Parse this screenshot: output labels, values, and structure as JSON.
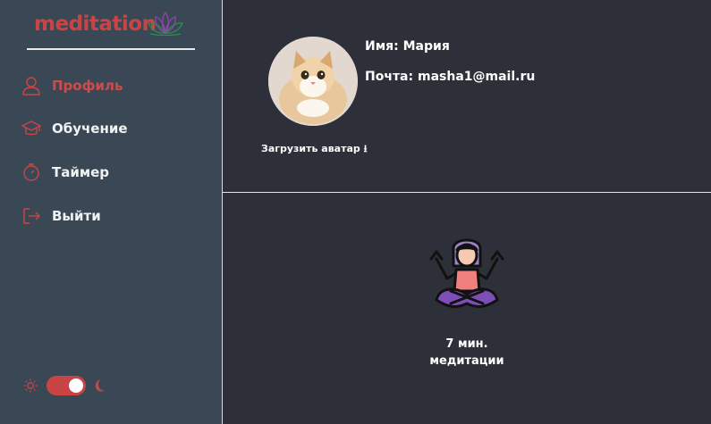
{
  "brand": {
    "name": "meditation",
    "color": "#c94545"
  },
  "sidebar": {
    "items": [
      {
        "label": "Профиль",
        "icon": "user-icon",
        "active": true
      },
      {
        "label": "Обучение",
        "icon": "graduation-cap-icon",
        "active": false
      },
      {
        "label": "Таймер",
        "icon": "stopwatch-icon",
        "active": false
      },
      {
        "label": "Выйти",
        "icon": "logout-icon",
        "active": false
      }
    ],
    "theme_toggle": {
      "state": "on",
      "left_icon": "sun-icon",
      "right_icon": "moon-icon"
    }
  },
  "profile": {
    "name_line": "Имя: Мария",
    "email_line": "Почта: masha1@mail.ru",
    "upload_label": "Загрузить аватар ⭳",
    "avatar": "cat-photo-avatar"
  },
  "stats": {
    "illustration": "meditating-person-icon",
    "line1": "7 мин.",
    "line2": "медитации"
  },
  "colors": {
    "accent": "#c94545",
    "sidebar_bg": "#3a4856",
    "main_bg": "#2d3038"
  }
}
